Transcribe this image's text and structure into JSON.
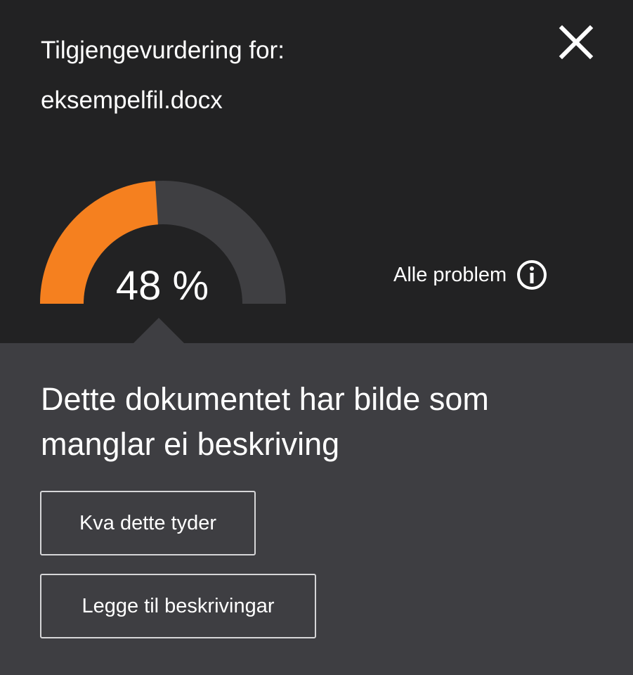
{
  "header": {
    "title_label": "Tilgjengevurdering for:",
    "file_name": "eksempelfil.docx",
    "close_icon": "close-icon"
  },
  "score": {
    "percent": 48,
    "label": "48 %",
    "colors": {
      "filled": "#f5801f",
      "track": "#3f3f42"
    }
  },
  "all_problems": {
    "label": "Alle problem",
    "icon": "info-icon"
  },
  "issue": {
    "text": "Dette dokumentet har bilde som manglar ei beskriving"
  },
  "buttons": {
    "meaning_label": "Kva dette tyder",
    "add_label": "Legge til beskrivingar"
  }
}
